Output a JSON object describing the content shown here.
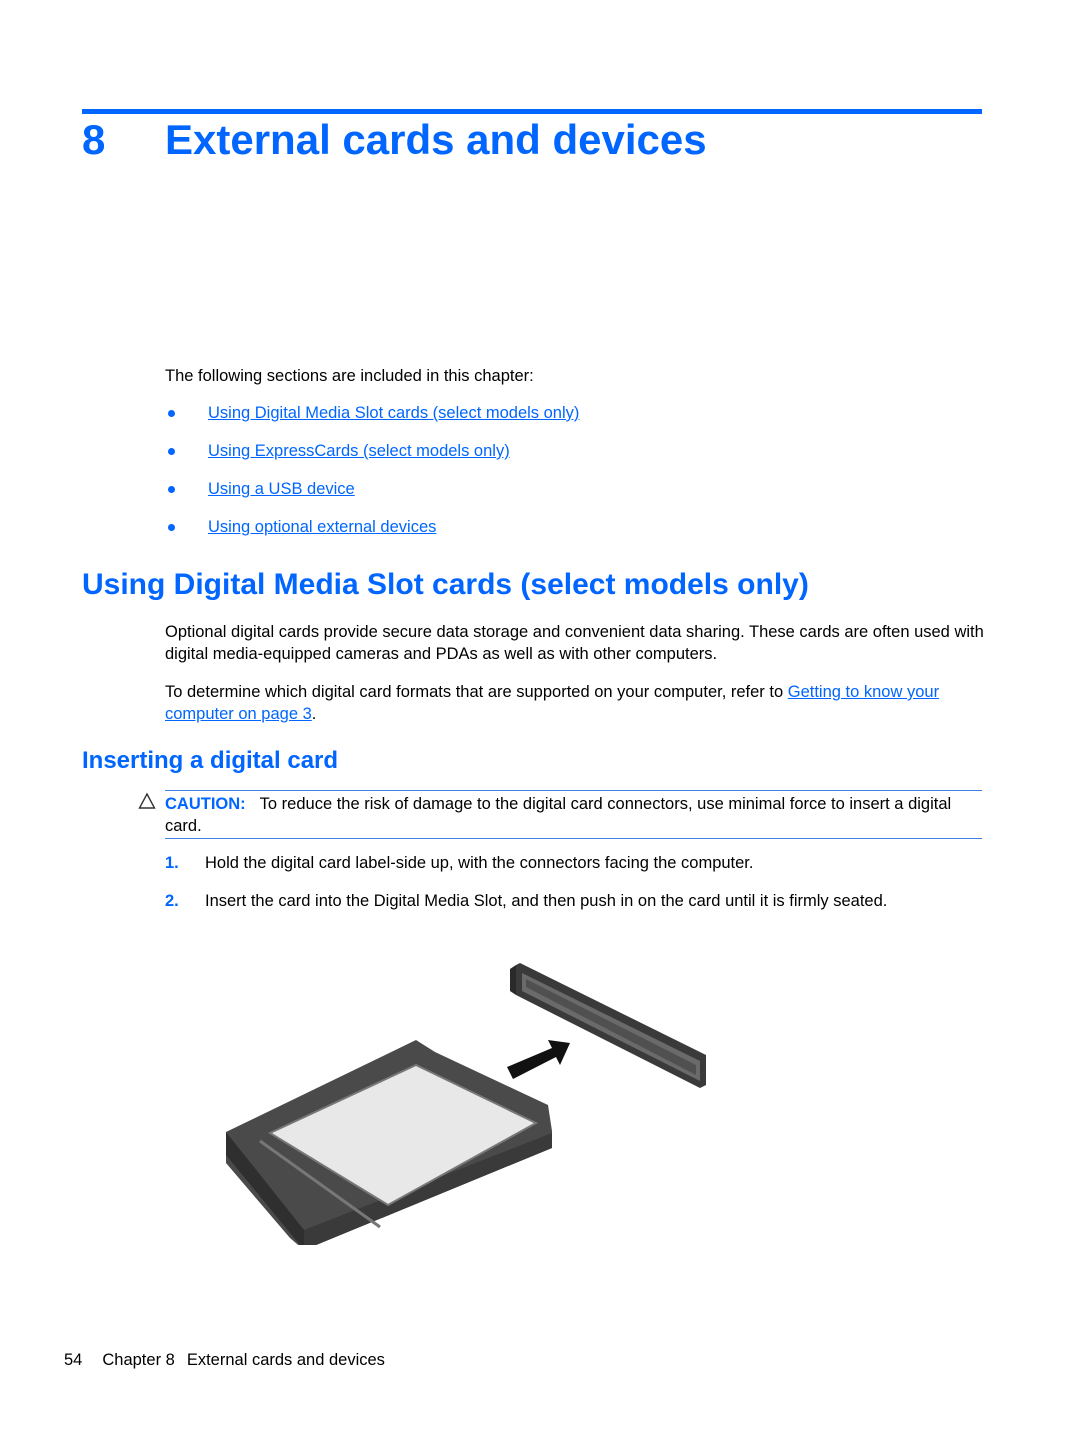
{
  "chapter": {
    "number": "8",
    "title": "External cards and devices",
    "accent_color": "#0066ff"
  },
  "intro": {
    "text": "The following sections are included in this chapter:",
    "links": [
      {
        "label": "Using Digital Media Slot cards (select models only)"
      },
      {
        "label": "Using ExpressCards (select models only)"
      },
      {
        "label": "Using a USB device"
      },
      {
        "label": "Using optional external devices"
      }
    ]
  },
  "section": {
    "heading": "Using Digital Media Slot cards (select models only)",
    "paragraph1": "Optional digital cards provide secure data storage and convenient data sharing. These cards are often used with digital media-equipped cameras and PDAs as well as with other computers.",
    "paragraph2_prefix": "To determine which digital card formats that are supported on your computer, refer to ",
    "paragraph2_link": "Getting to know your computer on page 3",
    "paragraph2_suffix": "."
  },
  "subsection": {
    "heading": "Inserting a digital card",
    "caution": {
      "icon": "warning-triangle-icon",
      "label": "CAUTION:",
      "text": "To reduce the risk of damage to the digital card connectors, use minimal force to insert a digital card."
    },
    "steps": [
      {
        "number": "1.",
        "text": "Hold the digital card label-side up, with the connectors facing the computer."
      },
      {
        "number": "2.",
        "text": "Insert the card into the Digital Media Slot, and then push in on the card until it is firmly seated."
      }
    ],
    "figure": {
      "description": "Illustration of a digital memory card being inserted into a slot",
      "icon": "sd-card-insert-illustration"
    }
  },
  "footer": {
    "page_number": "54",
    "chapter_label": "Chapter 8",
    "chapter_title": "External cards and devices"
  }
}
